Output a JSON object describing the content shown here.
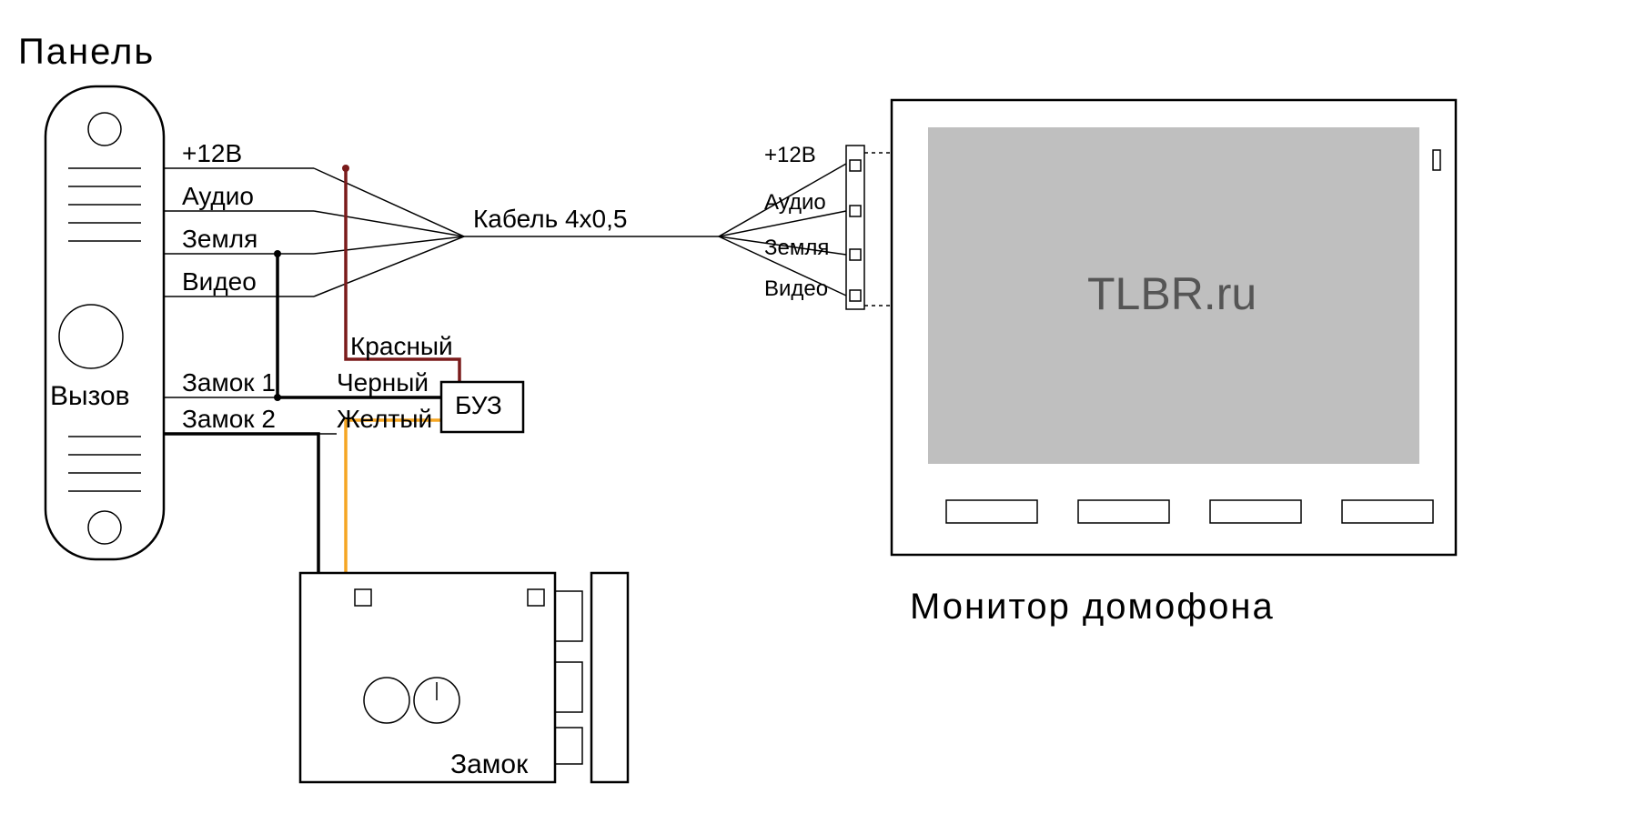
{
  "panel": {
    "title": "Панель",
    "call": "Вызов"
  },
  "wires_left": {
    "p12": "+12В",
    "audio": "Аудио",
    "ground": "Земля",
    "video": "Видео",
    "lock1": "Замок 1",
    "lock2": "Замок 2"
  },
  "cable": "Кабель 4х0,5",
  "wires_right": {
    "p12": "+12В",
    "audio": "Аудио",
    "ground": "Земля",
    "video": "Видео"
  },
  "buz": {
    "label": "БУЗ",
    "red": "Красный",
    "black": "Черный",
    "yellow": "Желтый"
  },
  "lock": "Замок",
  "monitor": {
    "screen": "TLBR.ru",
    "title": "Монитор домофона"
  }
}
